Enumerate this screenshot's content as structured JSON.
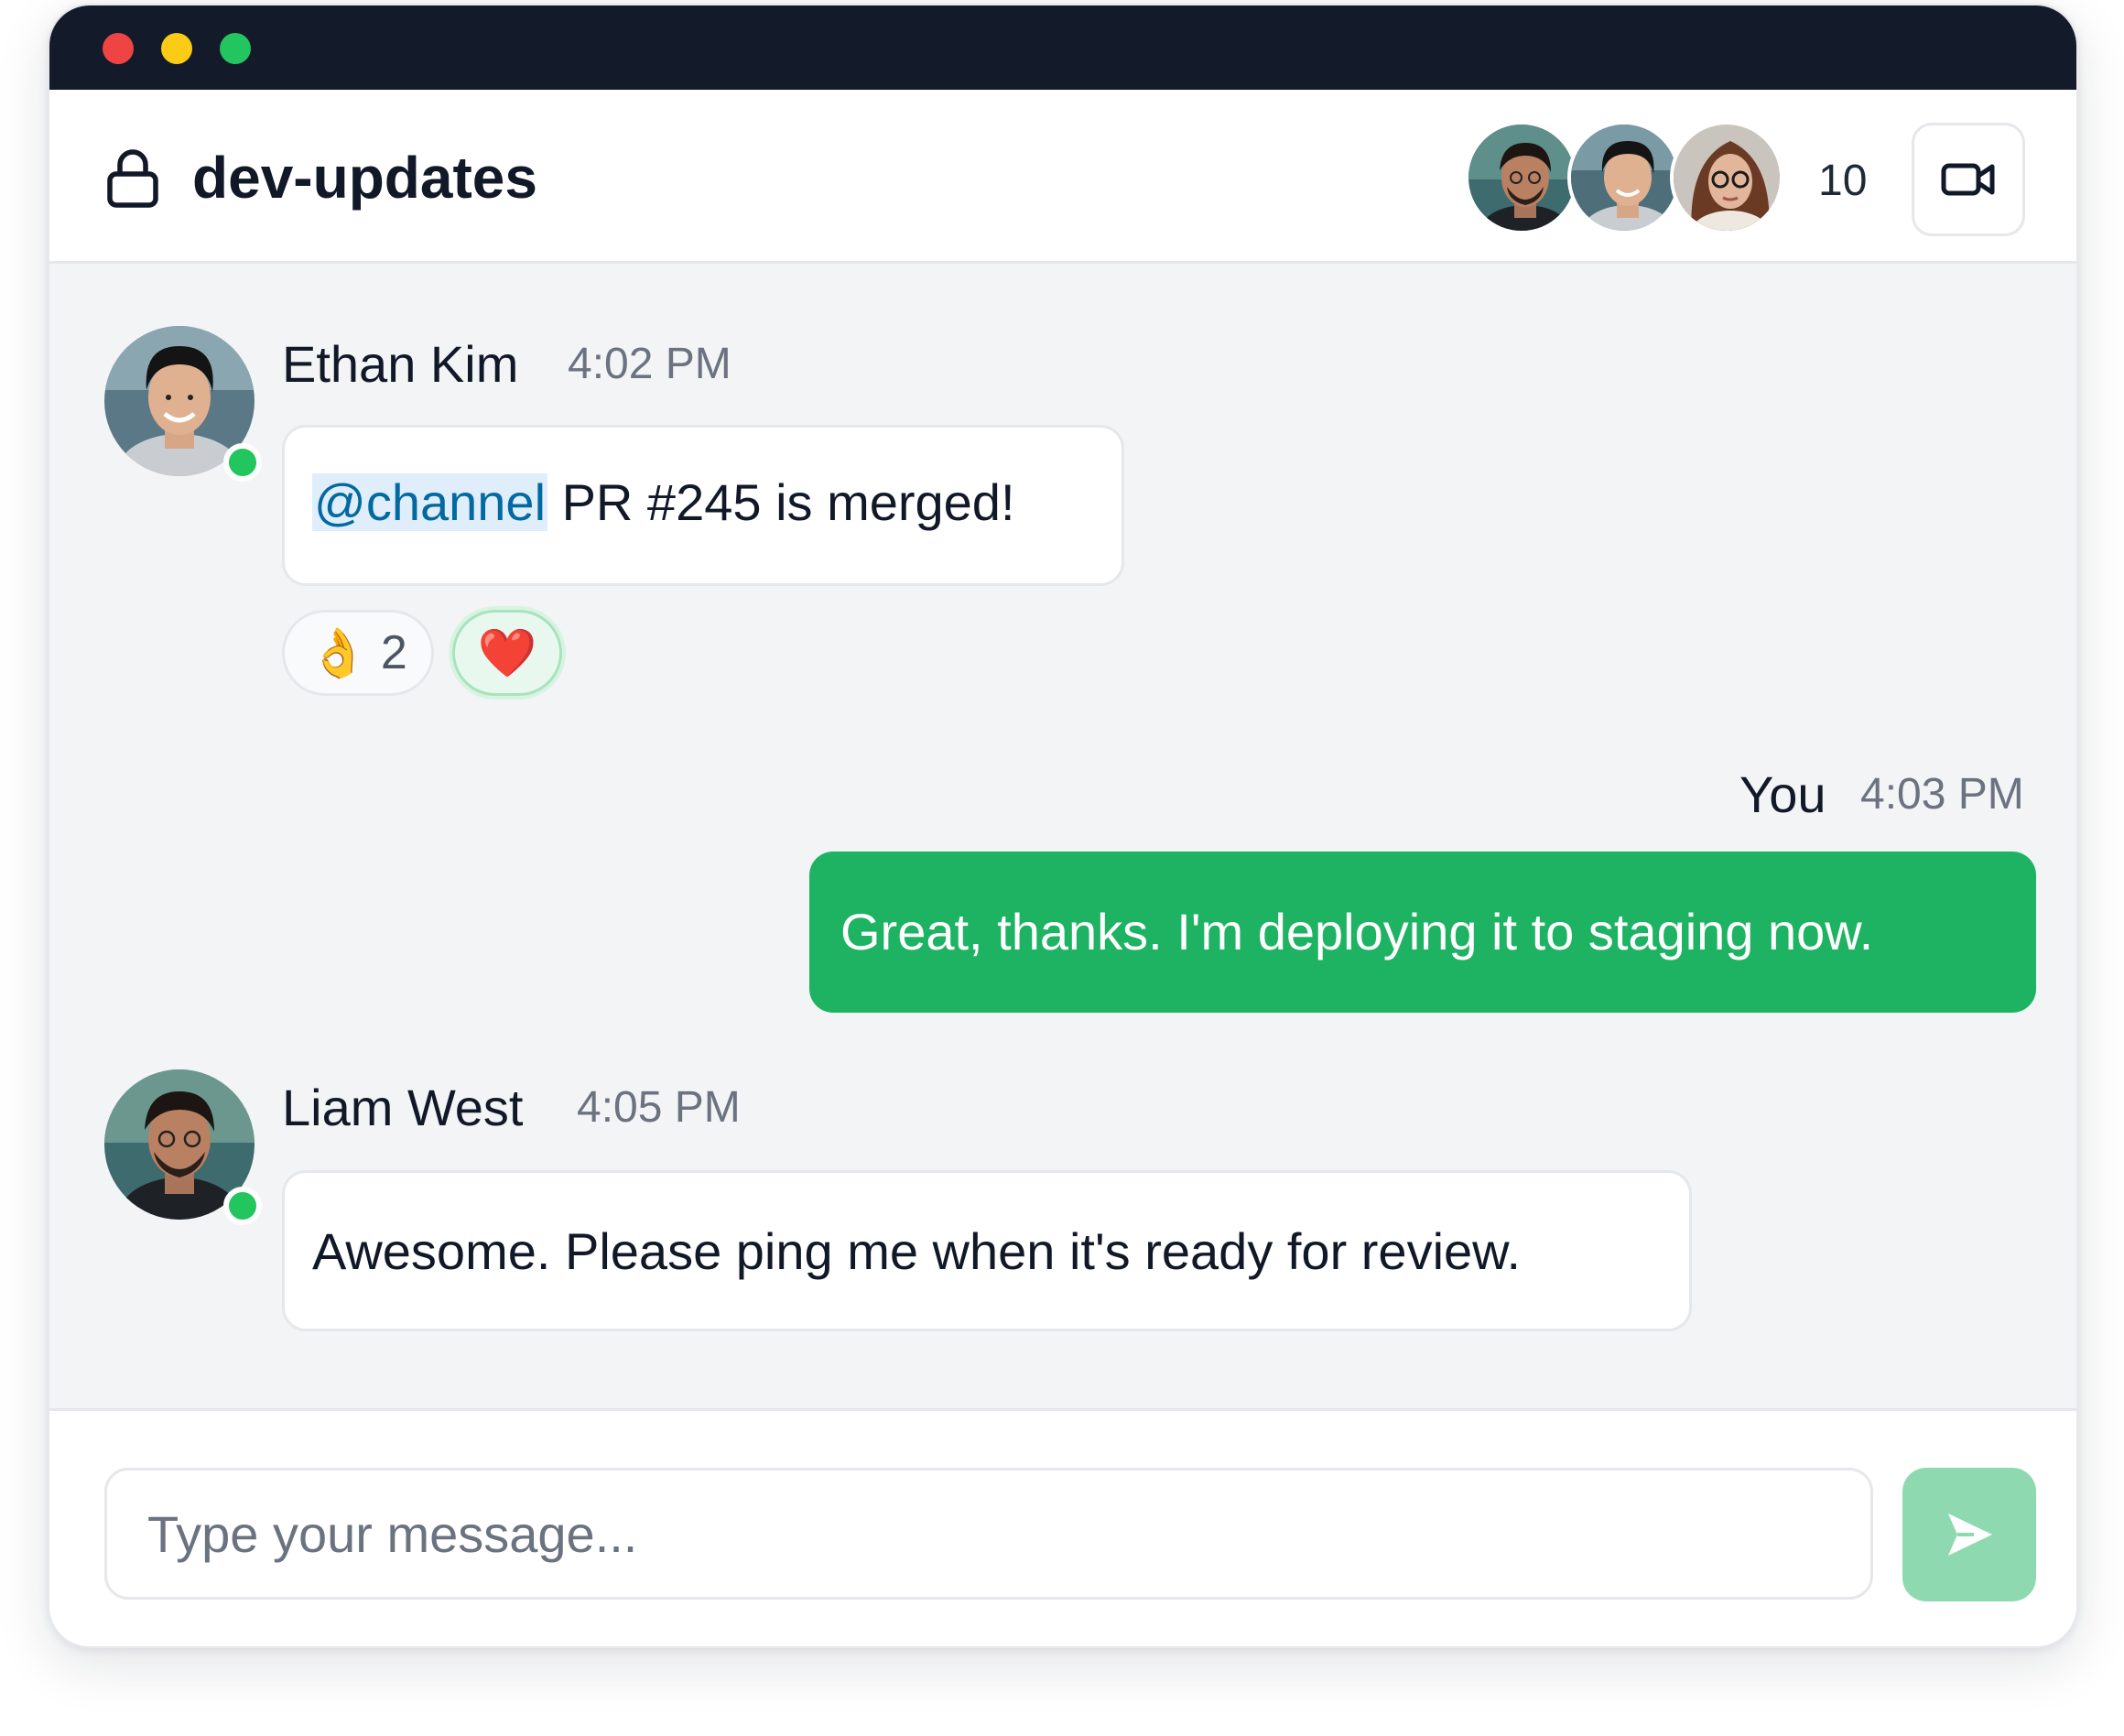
{
  "window": {
    "traffic_lights": [
      "close",
      "minimize",
      "maximize"
    ]
  },
  "header": {
    "title": "dev-updates",
    "icon": "lock-icon",
    "member_count": "10",
    "video_icon": "video-camera-icon"
  },
  "messages": [
    {
      "sender": "Ethan Kim",
      "time": "4:02 PM",
      "mention": "@channel",
      "text": " PR #245 is merged!",
      "online": true,
      "reactions": [
        {
          "emoji": "👌",
          "count": "2",
          "selected": false
        },
        {
          "emoji": "❤️",
          "count": "",
          "selected": true
        }
      ]
    },
    {
      "sender": "You",
      "time": "4:03 PM",
      "text": "Great, thanks. I'm deploying it to staging now.",
      "own": true
    },
    {
      "sender": "Liam West",
      "time": "4:05 PM",
      "text": "Awesome. Please ping me when it's ready for review.",
      "online": true
    }
  ],
  "composer": {
    "placeholder": "Type your message...",
    "value": "",
    "send_icon": "send-icon"
  },
  "colors": {
    "titlebar": "#131a2a",
    "accent": "#1db363",
    "send_disabled": "#8ed9b0",
    "online": "#22c55e",
    "mention_bg": "#e0eefc",
    "mention_text": "#0369a1"
  }
}
